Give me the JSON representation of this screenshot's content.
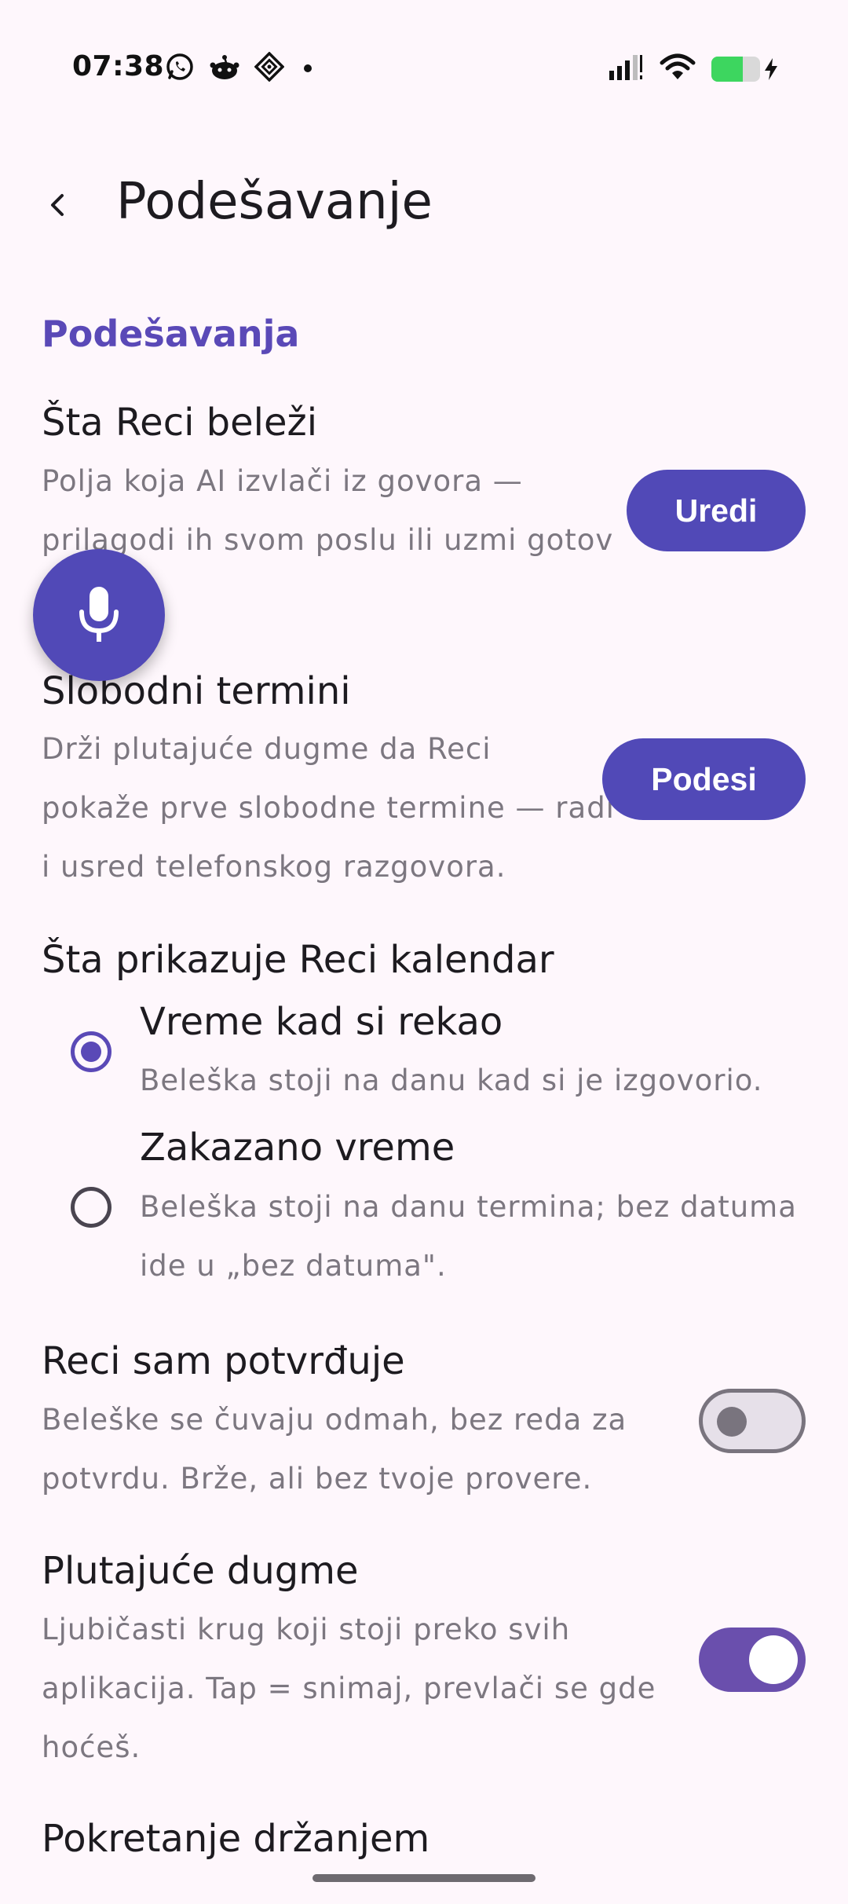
{
  "status_bar": {
    "time": "07:38",
    "battery_level": 0.65
  },
  "app_bar": {
    "title": "Podešavanje"
  },
  "section": {
    "header": "Podešavanja"
  },
  "fields_setting": {
    "title": "Šta Reci beleži",
    "desc_line1": "Polja koja AI izvlači iz govora —",
    "desc_line2": "prilagodi ih svom poslu ili uzmi gotov",
    "button_label": "Uredi"
  },
  "free_slots_setting": {
    "title": "Slobodni termini",
    "desc_line1": "Drži plutajuće dugme da Reci",
    "desc_line2": "pokaže prve slobodne termine — radi",
    "desc_line3": "i usred telefonskog razgovora.",
    "button_label": "Podesi"
  },
  "calendar_setting": {
    "title": "Šta prikazuje Reci kalendar",
    "options": [
      {
        "title": "Vreme kad si rekao",
        "desc_line1": "Beleška stoji na danu kad si je izgovorio.",
        "selected": true
      },
      {
        "title": "Zakazano vreme",
        "desc_line1": "Beleška stoji na danu termina; bez datuma",
        "desc_line2": "ide u „bez datuma\".",
        "selected": false
      }
    ]
  },
  "auto_confirm_setting": {
    "title": "Reci sam potvrđuje",
    "desc_line1": "Beleške se čuvaju odmah, bez reda za",
    "desc_line2": "potvrdu. Brže, ali bez tvoje provere.",
    "enabled": false
  },
  "floating_button_setting": {
    "title": "Plutajuće dugme",
    "desc_line1": "Ljubičasti krug koji stoji preko svih",
    "desc_line2": "aplikacija. Tap = snimaj, prevlači se gde",
    "desc_line3": "hoćeš.",
    "enabled": true
  },
  "hold_start_setting": {
    "title": "Pokretanje držanjem"
  },
  "colors": {
    "accent": "#5149B7",
    "background": "#FEF7FC",
    "switch_on": "#6A4FAD"
  },
  "icons": {
    "back": "chevron-left-icon",
    "fab": "microphone-icon"
  }
}
